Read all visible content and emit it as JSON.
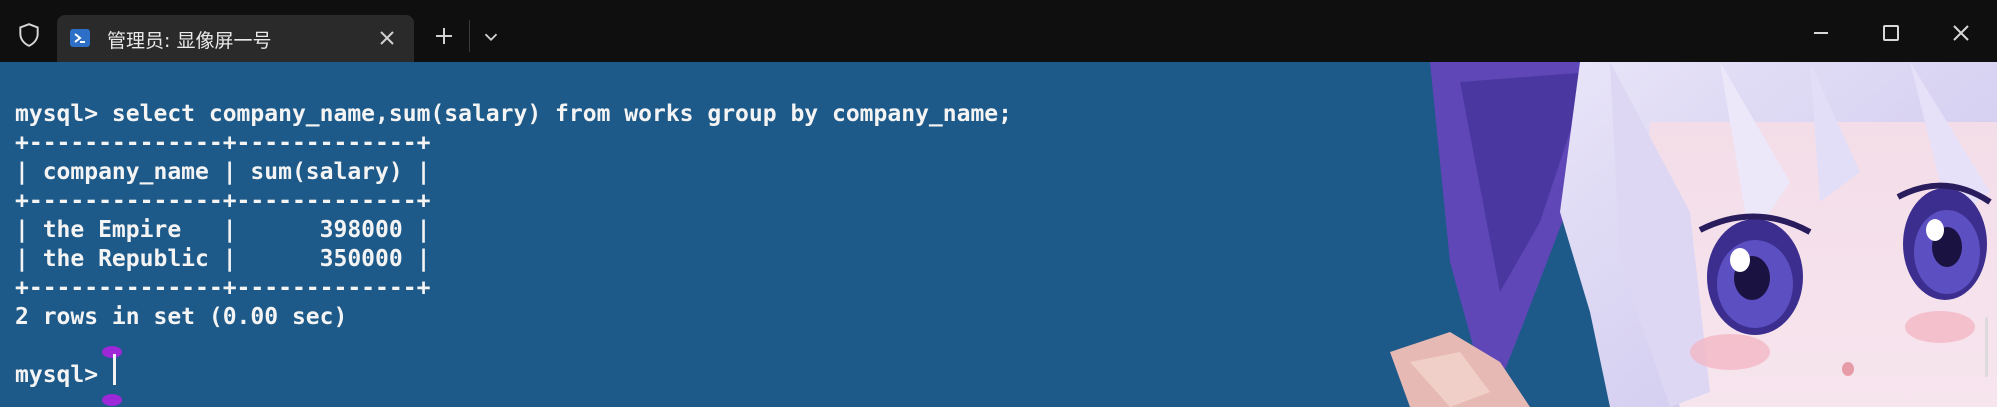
{
  "tab": {
    "title": "管理员: 显像屏一号"
  },
  "terminal": {
    "command_line": "mysql> select company_name,sum(salary) from works group by company_name;",
    "table_border_top": "+--------------+-------------+",
    "table_header": "| company_name | sum(salary) |",
    "table_border_mid": "+--------------+-------------+",
    "rows": [
      "| the Empire   |      398000 |",
      "| the Republic |      350000 |"
    ],
    "table_border_bottom": "+--------------+-------------+",
    "result_summary": "2 rows in set (0.00 sec)",
    "prompt": "mysql> "
  },
  "icons": {
    "shield": "shield-icon",
    "tab_powershell": "powershell-icon",
    "tab_close": "close-icon",
    "new_tab": "plus-icon",
    "dropdown": "chevron-down-icon",
    "minimize": "minimize-icon",
    "maximize": "maximize-icon",
    "close": "close-icon"
  },
  "colors": {
    "terminal_bg": "#1d5a89",
    "titlebar_bg": "#0f0f0f",
    "tab_bg": "#2a2a2a",
    "cursor_marker": "#9c28d8"
  }
}
